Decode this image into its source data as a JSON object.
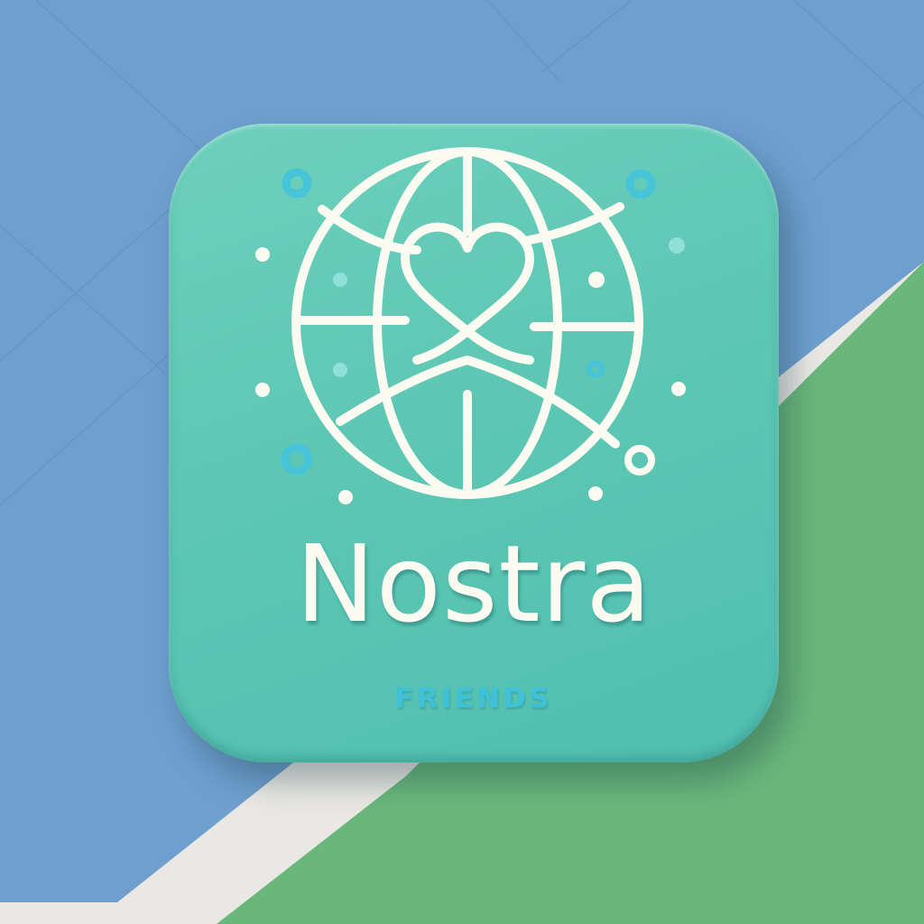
{
  "logo": {
    "name": "Nostra",
    "tagline": "FRIENDS",
    "emblem_icon": "globe-heart-icon",
    "decoration_icon": "network-node-icon"
  },
  "colors": {
    "tile": "#5ec7b4",
    "line": "#fbfbf1",
    "accent": "#3ec1db",
    "background_blue": "#6e9fce",
    "background_green": "#6ab77c",
    "background_light": "#eae8e4"
  }
}
